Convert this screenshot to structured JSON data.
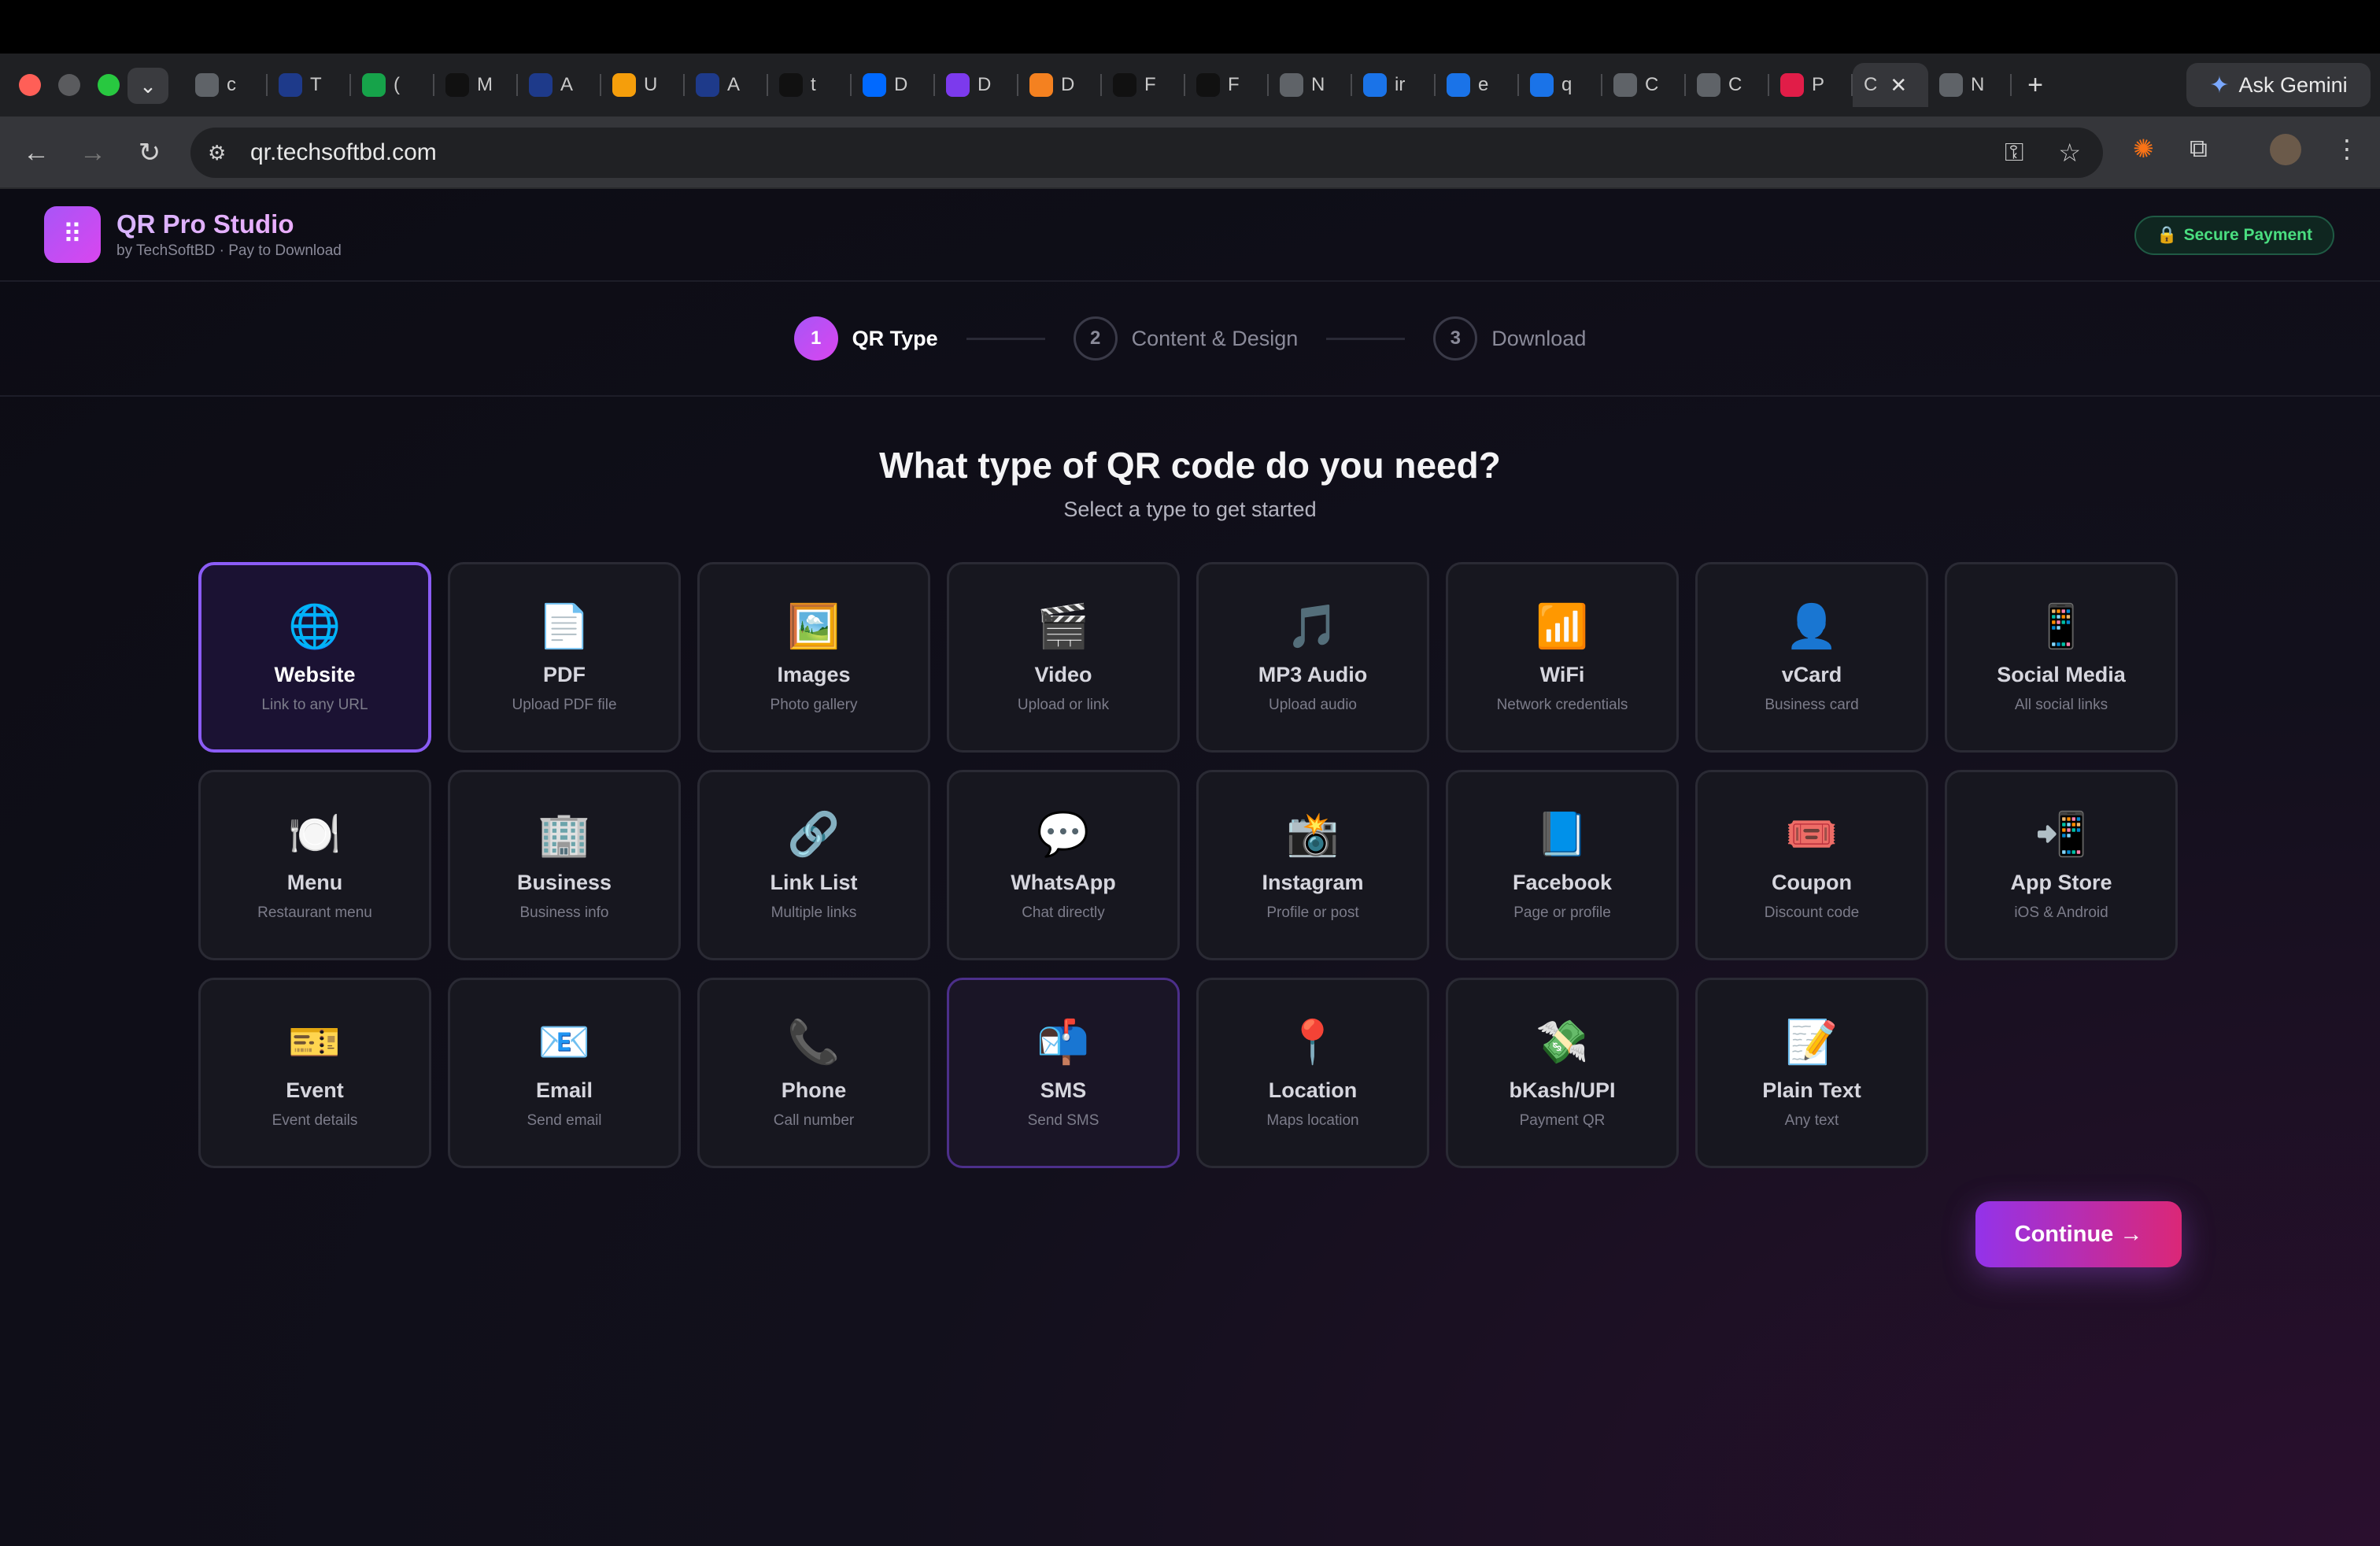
{
  "browser": {
    "tabs": [
      {
        "letter": "c",
        "icon": "globe-icon",
        "color": "#5f6368"
      },
      {
        "letter": "T",
        "icon": "site-icon",
        "color": "#1e3a8a"
      },
      {
        "letter": "(",
        "icon": "badge-icon",
        "color": "#16a34a"
      },
      {
        "letter": "M",
        "icon": "openai-icon",
        "color": "#111111"
      },
      {
        "letter": "A",
        "icon": "site-icon",
        "color": "#1e3a8a"
      },
      {
        "letter": "U",
        "icon": "analytics-icon",
        "color": "#f59e0b"
      },
      {
        "letter": "A",
        "icon": "site-icon",
        "color": "#1e3a8a"
      },
      {
        "letter": "t",
        "icon": "github-icon",
        "color": "#111111"
      },
      {
        "letter": "D",
        "icon": "digitalocean-icon",
        "color": "#0069ff"
      },
      {
        "letter": "D",
        "icon": "site-icon",
        "color": "#7c3aed"
      },
      {
        "letter": "D",
        "icon": "cloudflare-icon",
        "color": "#f48120"
      },
      {
        "letter": "F",
        "icon": "github-icon",
        "color": "#111111"
      },
      {
        "letter": "F",
        "icon": "github-icon",
        "color": "#111111"
      },
      {
        "letter": "N",
        "icon": "chrome-icon",
        "color": "#5f6368"
      },
      {
        "letter": "ir",
        "icon": "drive-icon",
        "color": "#1a73e8"
      },
      {
        "letter": "e",
        "icon": "docs-icon",
        "color": "#1a73e8"
      },
      {
        "letter": "q",
        "icon": "docs-icon",
        "color": "#1a73e8"
      },
      {
        "letter": "C",
        "icon": "globe-icon",
        "color": "#5f6368"
      },
      {
        "letter": "C",
        "icon": "globe-icon",
        "color": "#5f6368"
      },
      {
        "letter": "P",
        "icon": "site-icon",
        "color": "#e11d48"
      }
    ],
    "active_tab_letter": "C",
    "after_tab_letter": "N",
    "ask_gemini": "Ask Gemini",
    "url": "qr.techsoftbd.com"
  },
  "app": {
    "title": "QR Pro Studio",
    "subtitle": "by TechSoftBD · Pay to Download",
    "secure_badge": "Secure Payment"
  },
  "steps": [
    {
      "num": "1",
      "label": "QR Type"
    },
    {
      "num": "2",
      "label": "Content & Design"
    },
    {
      "num": "3",
      "label": "Download"
    }
  ],
  "heading": {
    "title": "What type of QR code do you need?",
    "subtitle": "Select a type to get started"
  },
  "types": [
    {
      "icon": "🌐",
      "title": "Website",
      "desc": "Link to any URL"
    },
    {
      "icon": "📄",
      "title": "PDF",
      "desc": "Upload PDF file"
    },
    {
      "icon": "🖼️",
      "title": "Images",
      "desc": "Photo gallery"
    },
    {
      "icon": "🎬",
      "title": "Video",
      "desc": "Upload or link"
    },
    {
      "icon": "🎵",
      "title": "MP3 Audio",
      "desc": "Upload audio"
    },
    {
      "icon": "📶",
      "title": "WiFi",
      "desc": "Network credentials"
    },
    {
      "icon": "👤",
      "title": "vCard",
      "desc": "Business card"
    },
    {
      "icon": "📱",
      "title": "Social Media",
      "desc": "All social links"
    },
    {
      "icon": "🍽️",
      "title": "Menu",
      "desc": "Restaurant menu"
    },
    {
      "icon": "🏢",
      "title": "Business",
      "desc": "Business info"
    },
    {
      "icon": "🔗",
      "title": "Link List",
      "desc": "Multiple links"
    },
    {
      "icon": "💬",
      "title": "WhatsApp",
      "desc": "Chat directly"
    },
    {
      "icon": "📸",
      "title": "Instagram",
      "desc": "Profile or post"
    },
    {
      "icon": "📘",
      "title": "Facebook",
      "desc": "Page or profile"
    },
    {
      "icon": "🎟️",
      "title": "Coupon",
      "desc": "Discount code"
    },
    {
      "icon": "📲",
      "title": "App Store",
      "desc": "iOS & Android"
    },
    {
      "icon": "🎫",
      "title": "Event",
      "desc": "Event details"
    },
    {
      "icon": "📧",
      "title": "Email",
      "desc": "Send email"
    },
    {
      "icon": "📞",
      "title": "Phone",
      "desc": "Call number"
    },
    {
      "icon": "📬",
      "title": "SMS",
      "desc": "Send SMS"
    },
    {
      "icon": "📍",
      "title": "Location",
      "desc": "Maps location"
    },
    {
      "icon": "💸",
      "title": "bKash/UPI",
      "desc": "Payment QR"
    },
    {
      "icon": "📝",
      "title": "Plain Text",
      "desc": "Any text"
    }
  ],
  "selected_type": "Website",
  "hovered_type": "SMS",
  "continue_label": "Continue →"
}
